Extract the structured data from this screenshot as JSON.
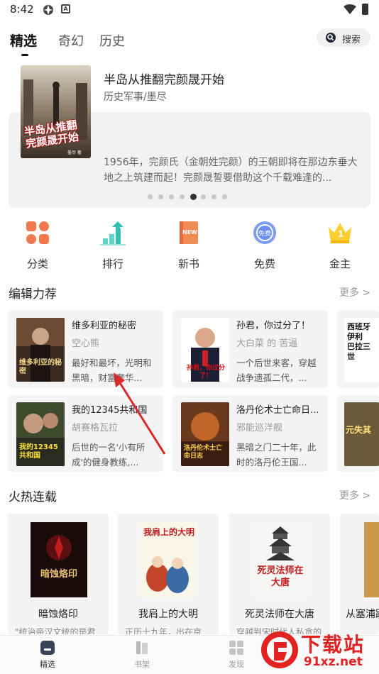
{
  "status_bar": {
    "time": "8:42",
    "small_icon_letter": "A"
  },
  "tabs": [
    {
      "label": "精选",
      "active": true
    },
    {
      "label": "奇幻",
      "active": false
    },
    {
      "label": "历史",
      "active": false
    }
  ],
  "search": {
    "label": "搜索"
  },
  "banner": {
    "title": "半岛从推翻完颜晟开始",
    "subtitle": "历史军事/墨尽",
    "description": "1956年，完颜氏（金朝姓完颜）的王朝即将在那边东垂大地之上筑建而起！完颜晟誓要借助这个千载难逢的...",
    "cover_text": "半岛从推翻完颜晟开始",
    "cover_author": "墨尽 著",
    "dot_count": 8,
    "active_dot": 4
  },
  "shortcuts": [
    {
      "label": "分类",
      "icon": "category-icon"
    },
    {
      "label": "排行",
      "icon": "ranking-icon"
    },
    {
      "label": "新书",
      "icon": "new-book-icon",
      "icon_text": "NEW"
    },
    {
      "label": "免费",
      "icon": "free-icon",
      "icon_text": "免费"
    },
    {
      "label": "金主",
      "icon": "crown-icon",
      "icon_text": "1"
    }
  ],
  "editor_picks": {
    "title": "编辑力荐",
    "more": "更多 >",
    "items": [
      {
        "title": "维多利亚的秘密",
        "author": "空心熊",
        "desc": "最好和最坏，光明和黑暗，财富奢华...",
        "cover_text": "维多利亚的秘密"
      },
      {
        "title": "孙君，你过分了！",
        "author": "大白菜 的 苦逼",
        "desc": "一个后世来客，穿越战争遗孤二代，...",
        "cover_text": "孙君，你过分了！"
      },
      {
        "title": "我的12345共和国",
        "author": "胡赛格瓦拉",
        "desc": "后世的一名'小有所成'的健身教练,...",
        "cover_text": "我的12345共和国"
      },
      {
        "title": "洛丹伦术士亡命日...",
        "author": "邪能巡洋舰",
        "desc": "黑暗之门二十年，此时的洛丹伦王国...",
        "cover_text": "洛丹伦术士亡命日志"
      }
    ],
    "partial_covers": [
      "西班牙 伊利 巴拉三世",
      "元失其"
    ]
  },
  "hot_serial": {
    "title": "火热连载",
    "more": "更多 >",
    "items": [
      {
        "title": "暗蚀烙印",
        "desc": "\"统治帝汉文统的是君",
        "cover_text": "暗蚀烙印"
      },
      {
        "title": "我肩上的大明",
        "desc": "正历十九年，出在京",
        "cover_text": "我肩上的大明"
      },
      {
        "title": "死灵法师在大唐",
        "desc": "穿越到宋时代人私贪的",
        "cover_text": "死灵法师在大唐"
      },
      {
        "title": "从塞浦路",
        "desc": "",
        "cover_text": "从塞浦路"
      }
    ]
  },
  "bottom_nav": [
    {
      "label": "精选",
      "active": true
    },
    {
      "label": "书架",
      "active": false
    },
    {
      "label": "发现",
      "active": false
    }
  ],
  "watermark": {
    "text1": "下载站",
    "text2": "91xz.net"
  },
  "colors": {
    "accent_orange": "#f07a4e",
    "teal": "#34c0b5",
    "arrow_red": "#d92a2a"
  }
}
